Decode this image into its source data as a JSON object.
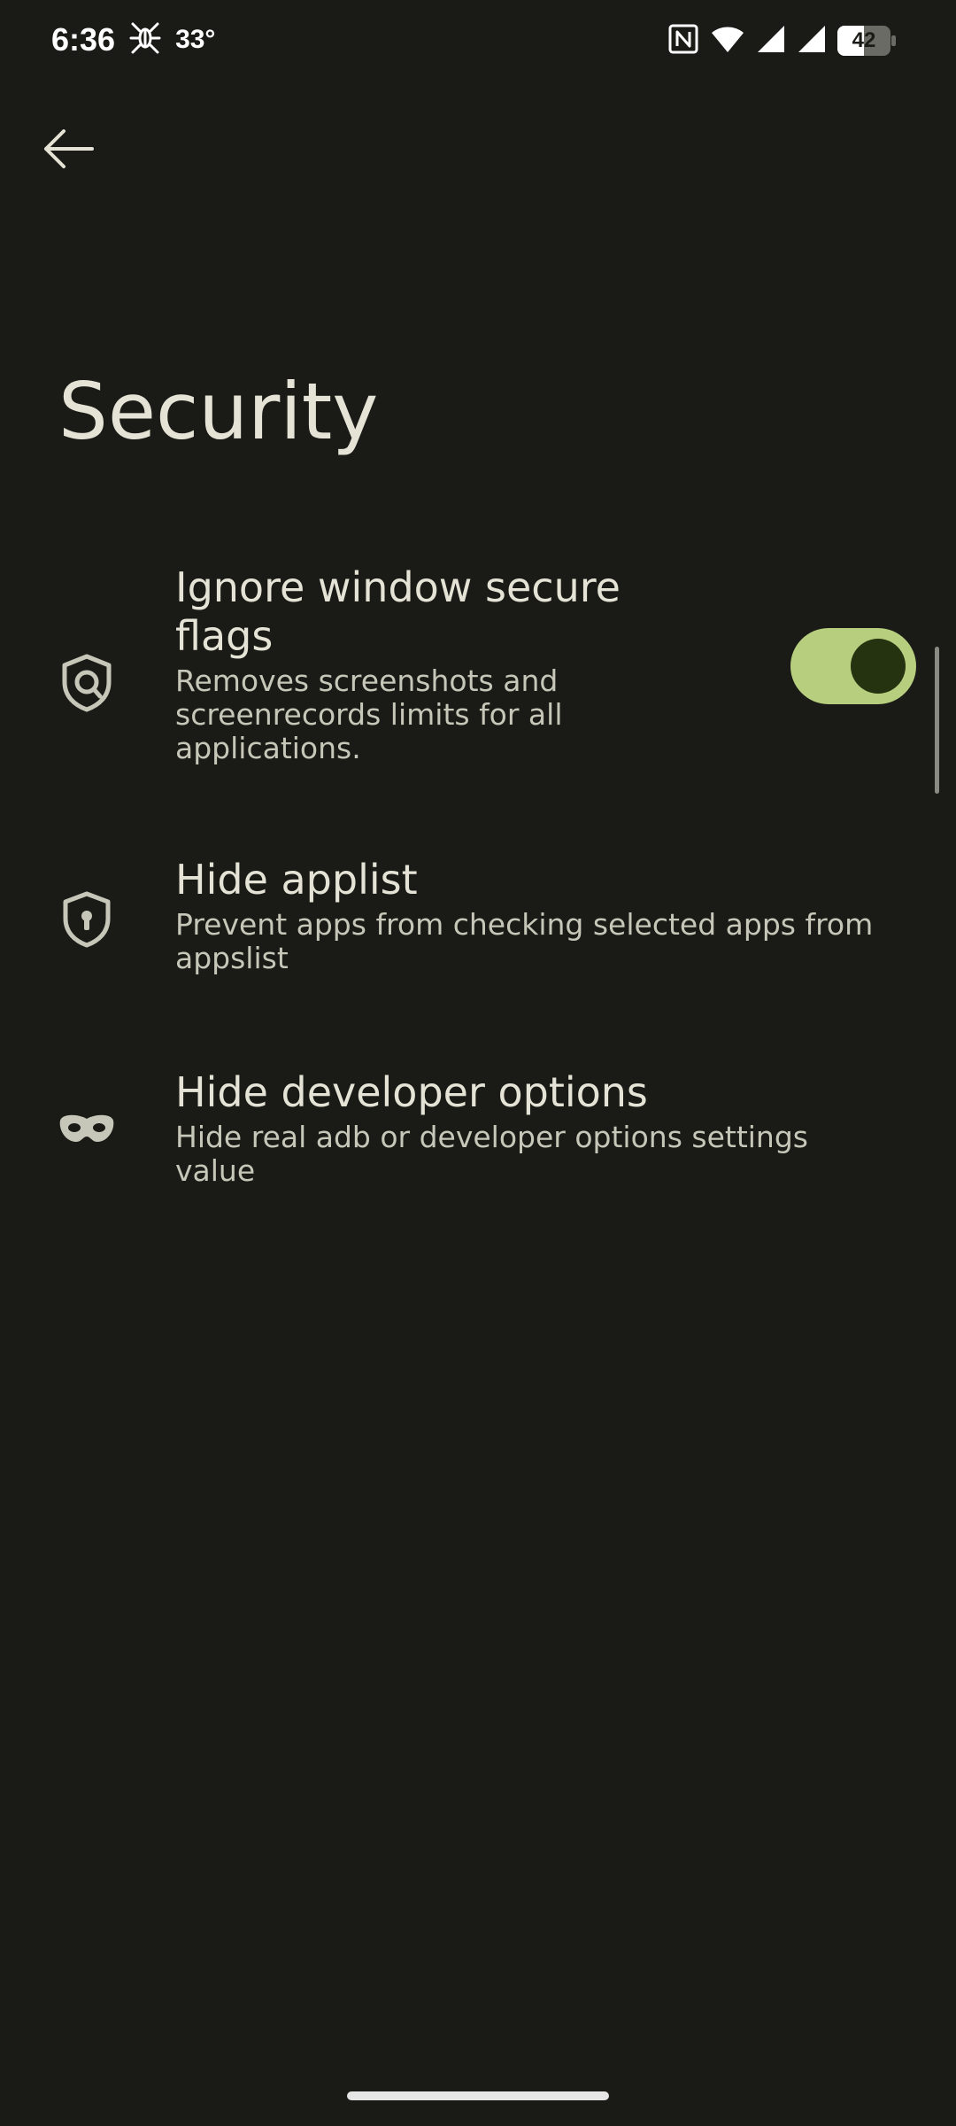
{
  "status_bar": {
    "time": "6:36",
    "temperature": "33°",
    "battery_level": "42",
    "icons": [
      "spider-notification-icon",
      "nfc-icon",
      "wifi-icon",
      "signal-icon",
      "signal-icon",
      "battery-icon"
    ]
  },
  "header": {
    "back_icon": "arrow-back-icon",
    "title": "Security"
  },
  "settings": [
    {
      "icon": "shield-target-icon",
      "title_line1": "Ignore window secure",
      "title_line2": "flags",
      "summary_line1": "Removes screenshots and",
      "summary_line2": "screenrecords limits for all",
      "summary_line3": "applications.",
      "has_switch": true,
      "switch_on": true
    },
    {
      "icon": "shield-lock-icon",
      "title": "Hide applist",
      "summary_line1": "Prevent apps from checking selected apps from",
      "summary_line2": "appslist"
    },
    {
      "icon": "mask-icon",
      "title": "Hide developer options",
      "summary_line1": "Hide real adb or developer options settings",
      "summary_line2": "value"
    }
  ],
  "colors": {
    "background": "#1a1b16",
    "text_primary": "#e4e3d6",
    "text_secondary": "#c6c7b8",
    "switch_track": "#b6ce7e",
    "switch_thumb": "#263310"
  }
}
